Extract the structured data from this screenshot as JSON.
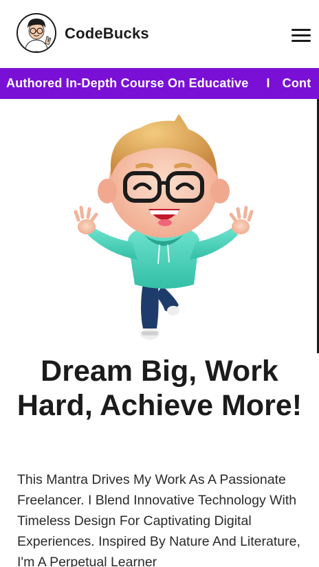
{
  "header": {
    "brand_name": "CodeBucks",
    "menu_icon": "hamburger-menu-icon"
  },
  "banner": {
    "items": [
      "Authored In-Depth Course On Educative",
      "Cont"
    ],
    "separator": "I",
    "background": "#7a10d6",
    "text_color": "#ffffff"
  },
  "hero": {
    "illustration": "waving-3d-character",
    "headline": "Dream Big, Work Hard, Achieve More!",
    "description": "This Mantra Drives My Work As A Passionate Freelancer. I Blend Innovative Technology With Timeless Design For Captivating Digital Experiences. Inspired By Nature And Literature, I'm A Perpetual Learner"
  }
}
